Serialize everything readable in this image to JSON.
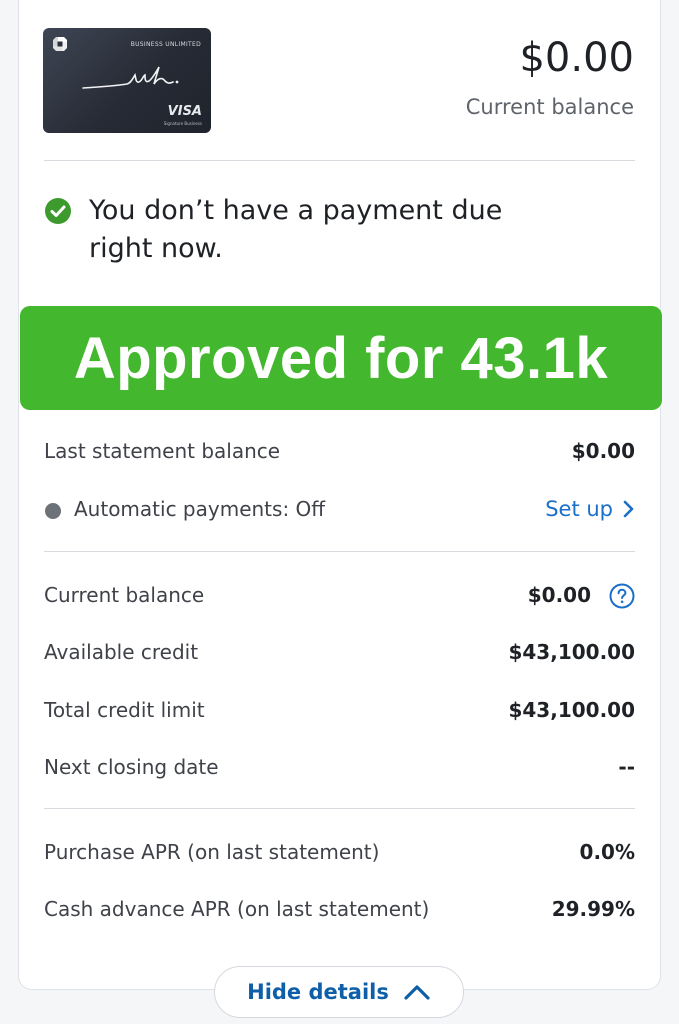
{
  "card": {
    "tier": "BUSINESS UNLIMITED",
    "script_logo": "ink.",
    "network": "VISA",
    "network_sub": "Signature Business"
  },
  "balance": {
    "amount": "$0.00",
    "label": "Current balance"
  },
  "payment_status": {
    "message": "You don’t have a payment due right now.",
    "icon": "check-circle-icon"
  },
  "banner": {
    "text": "Approved for 43.1k"
  },
  "statement": {
    "last_balance_label": "Last statement balance",
    "last_balance_value": "$0.00",
    "autopay_label": "Automatic payments: Off",
    "setup_label": "Set up"
  },
  "details": {
    "current_balance_label": "Current balance",
    "current_balance_value": "$0.00",
    "available_credit_label": "Available credit",
    "available_credit_value": "$43,100.00",
    "total_limit_label": "Total credit limit",
    "total_limit_value": "$43,100.00",
    "closing_date_label": "Next closing date",
    "closing_date_value": "--"
  },
  "apr": {
    "purchase_label": "Purchase APR (on last statement)",
    "purchase_value": "0.0%",
    "cash_label": "Cash advance APR (on last statement)",
    "cash_value": "29.99%"
  },
  "footer": {
    "hide_details_label": "Hide details"
  },
  "colors": {
    "accent_link": "#1a6fc8",
    "banner_green": "#43b72e",
    "check_green": "#3d9a2c"
  }
}
